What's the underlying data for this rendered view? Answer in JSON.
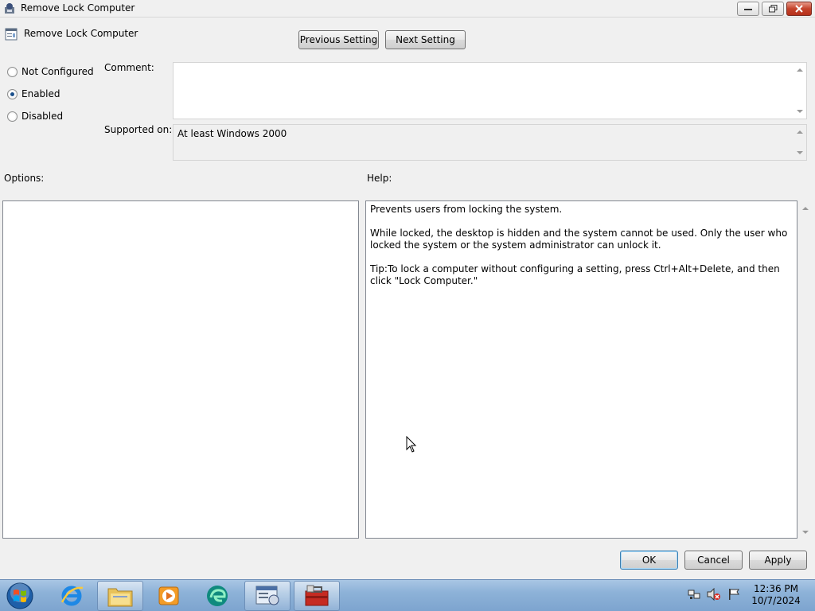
{
  "window": {
    "title": "Remove Lock Computer",
    "app_icon": "group-policy-icon"
  },
  "header": {
    "policy_title": "Remove Lock Computer",
    "policy_icon": "policy-setting-icon",
    "previous_label": "Previous Setting",
    "next_label": "Next Setting"
  },
  "state": {
    "options": [
      {
        "label": "Not Configured",
        "checked": false
      },
      {
        "label": "Enabled",
        "checked": true
      },
      {
        "label": "Disabled",
        "checked": false
      }
    ]
  },
  "comment": {
    "label": "Comment:",
    "value": ""
  },
  "supported": {
    "label": "Supported on:",
    "value": "At least Windows 2000"
  },
  "options_section": {
    "label": "Options:"
  },
  "help_section": {
    "label": "Help:",
    "paragraphs": [
      "Prevents users from locking the system.",
      "While locked, the desktop is hidden and the system cannot be used. Only the user who locked the system or the system administrator can unlock it.",
      "Tip:To lock a computer without configuring a setting, press Ctrl+Alt+Delete, and then click \"Lock Computer.\""
    ]
  },
  "footer": {
    "ok_label": "OK",
    "cancel_label": "Cancel",
    "apply_label": "Apply"
  },
  "taskbar": {
    "items": [
      {
        "icon": "internet-explorer-icon",
        "active": false
      },
      {
        "icon": "windows-explorer-icon",
        "active": true
      },
      {
        "icon": "media-player-icon",
        "active": false
      },
      {
        "icon": "edge-icon",
        "active": false
      },
      {
        "icon": "group-policy-editor-icon",
        "active": true
      },
      {
        "icon": "toolbox-icon",
        "active": true
      }
    ],
    "clock_time": "12:36 PM",
    "clock_date": "10/7/2024"
  },
  "colors": {
    "accent": "#3c7fb1",
    "taskbar": "#8db2d8"
  }
}
